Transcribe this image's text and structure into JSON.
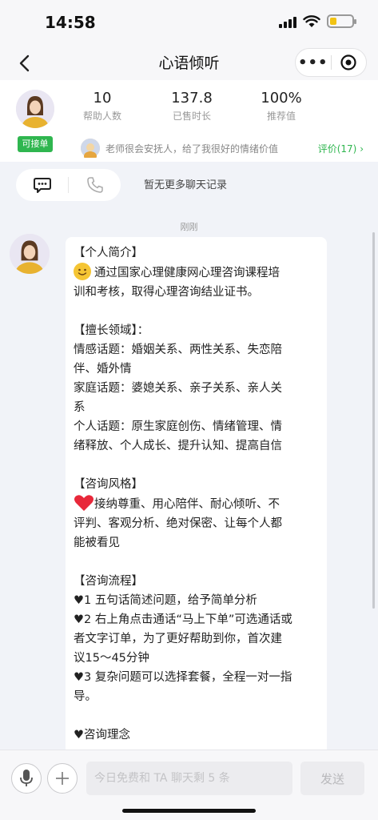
{
  "status_bar": {
    "time": "14:58",
    "battery_level": 0.3,
    "battery_color": "#f2c313"
  },
  "nav": {
    "title": "心语倾听",
    "more_label": "•••"
  },
  "counselor": {
    "badge": "可接单",
    "stats": [
      {
        "value": "10",
        "label": "帮助人数"
      },
      {
        "value": "137.8",
        "label": "已售时长"
      },
      {
        "value": "100%",
        "label": "推荐值"
      }
    ],
    "review_snippet": "老师很会安抚人，给了我很好的情绪价值",
    "review_link": "评价(17)",
    "accent_color": "#2fb64f"
  },
  "chat": {
    "no_more_records": "暂无更多聊天记录",
    "timestamp": "刚刚",
    "message_lines": [
      "【个人简介】",
      "通过国家心理健康网心理咨询课程培",
      "训和考核，取得心理咨询结业证书。",
      "",
      "【擅长领域】：",
      "情感话题：婚姻关系、两性关系、失恋陪",
      "伴、婚外情",
      "家庭话题：婆媳关系、亲子关系、亲人关",
      "系",
      "个人话题：原生家庭创伤、情绪管理、情",
      "绪释放、个人成长、提升认知、提高自信",
      "",
      "【咨询风格】",
      "接纳尊重、用心陪伴、耐心倾听、不",
      "评判、客观分析、绝对保密、让每个人都",
      "能被看见",
      "",
      "【咨询流程】",
      "♥1 五句话简述问题，给予简单分析",
      "♥2 右上角点击通话“马上下单”可选通话或",
      "者文字订单，为了更好帮助到你，首次建",
      "议15～45分钟",
      "♥3 复杂问题可以选择套餐，全程一对一指",
      "导。",
      "",
      "♥咨询理念"
    ]
  },
  "input": {
    "placeholder": "今日免费和 TA 聊天剩 5 条",
    "send_label": "发送"
  }
}
